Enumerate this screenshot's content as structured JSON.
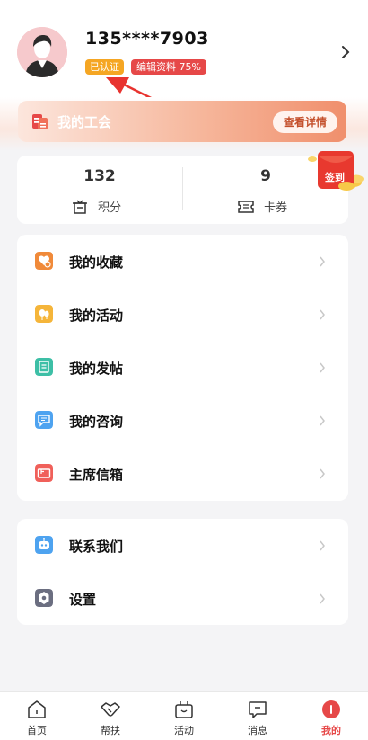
{
  "profile": {
    "phone": "135****7903",
    "verified_label": "已认证",
    "edit_profile_label": "编辑资料 75%"
  },
  "union": {
    "title": "我的工会",
    "details_button": "查看详情"
  },
  "stats": {
    "points_value": "132",
    "points_label": "积分",
    "coupons_value": "9",
    "coupons_label": "卡券"
  },
  "signin_label": "签到",
  "menu_main": [
    {
      "label": "我的收藏",
      "icon": "favorite-icon",
      "color": "#f08a3a"
    },
    {
      "label": "我的活动",
      "icon": "activity-icon",
      "color": "#f5b53a"
    },
    {
      "label": "我的发帖",
      "icon": "post-icon",
      "color": "#3dbfa6"
    },
    {
      "label": "我的咨询",
      "icon": "consult-icon",
      "color": "#4ea3f0"
    },
    {
      "label": "主席信箱",
      "icon": "mailbox-icon",
      "color": "#f0605a"
    }
  ],
  "menu_other": [
    {
      "label": "联系我们",
      "icon": "contact-robot-icon",
      "color": "#4ea3f0"
    },
    {
      "label": "设置",
      "icon": "settings-icon",
      "color": "#6b6e80"
    }
  ],
  "tabs": [
    {
      "label": "首页",
      "icon": "home-icon"
    },
    {
      "label": "帮扶",
      "icon": "help-handshake-icon"
    },
    {
      "label": "活动",
      "icon": "activity-tab-icon"
    },
    {
      "label": "消息",
      "icon": "message-icon"
    },
    {
      "label": "我的",
      "icon": "profile-tab-icon",
      "active": true
    }
  ],
  "colors": {
    "accent_red": "#e64848",
    "verified_orange": "#f5a623"
  }
}
